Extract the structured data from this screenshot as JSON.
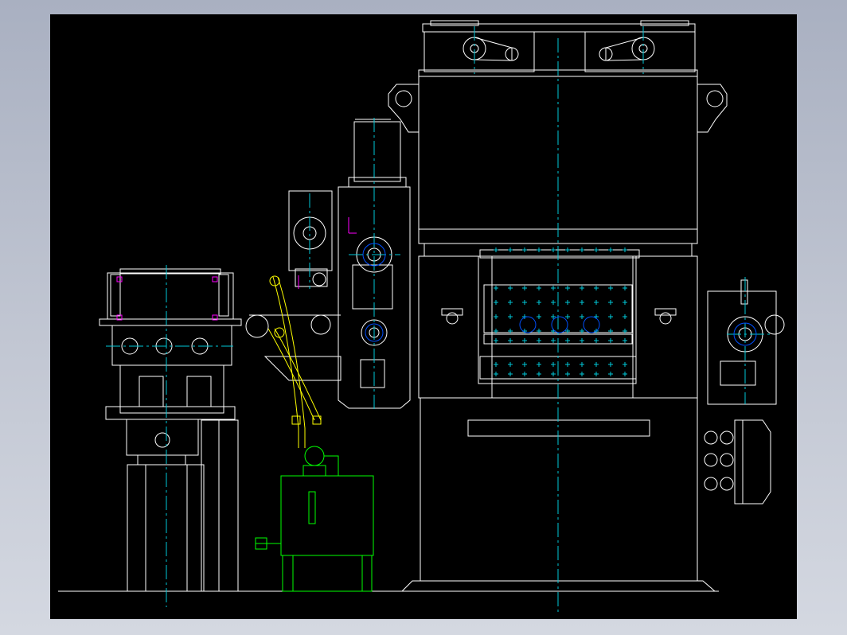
{
  "app": {
    "background_gradient": [
      "#a9b0c1",
      "#d4d8e1"
    ],
    "viewport_background": "#000000"
  },
  "drawing": {
    "subject": "press-machine-assembly-elevation",
    "colors": {
      "outline": "#ffffff",
      "centerline": "#00c8d8",
      "hydraulic": "#00ff00",
      "pipe": "#ffff00",
      "accent": "#ff00ff",
      "fastener": "#0050ff"
    }
  }
}
